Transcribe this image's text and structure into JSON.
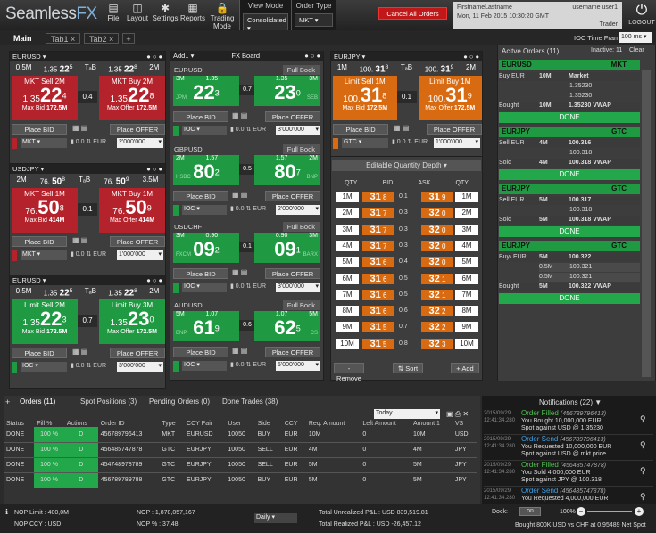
{
  "app": {
    "logo_main": "Seamless",
    "logo_suffix": "FX",
    "cancel_all": "Cancel All Orders",
    "logout": "LOGOUT"
  },
  "toolbar": [
    {
      "label": "File",
      "icon": "file-icon"
    },
    {
      "label": "Layout",
      "icon": "layout-icon"
    },
    {
      "label": "Settings",
      "icon": "gear-icon"
    },
    {
      "label": "Reports",
      "icon": "reports-icon"
    },
    {
      "label": "Trading Mode",
      "icon": "lock-icon"
    }
  ],
  "view_mode": {
    "title": "View Mode",
    "value": "Consolidated"
  },
  "order_type": {
    "title": "Order Type",
    "value": "MKT"
  },
  "user": {
    "name": "FirstnameLastname",
    "username": "username user1",
    "datetime": "Mon, 11 Feb 2015 10:30:20 GMT",
    "role": "Trader"
  },
  "tabs": [
    "Main",
    "Tab1",
    "Tab2"
  ],
  "ioc_time": {
    "label": "IOC Time Frame",
    "value": "100 ms"
  },
  "fx_board": {
    "add": "Add..",
    "title": "FX Board",
    "full_book": "Full Book",
    "tiles": [
      {
        "pair": "EURUSD",
        "left_size": "3M",
        "right_size": "3M",
        "sell_big": "1.35",
        "sell_pips": "22",
        "sell_frac": "3",
        "buy_big": "1.35",
        "buy_pips": "23",
        "buy_frac": "0",
        "spread": "0.7",
        "left_src": "JPM",
        "right_src": "SEB",
        "place_bid": "Place BID",
        "place_offer": "Place OFFER",
        "type": "IOC",
        "qty": "3'000'000",
        "ccy": "EUR"
      },
      {
        "pair": "GBPUSD",
        "left_size": "2M",
        "right_size": "2M",
        "sell_big": "1.57",
        "sell_pips": "80",
        "sell_frac": "2",
        "buy_big": "1.57",
        "buy_pips": "80",
        "buy_frac": "7",
        "spread": "0.5",
        "left_src": "HSBC",
        "right_src": "BNP",
        "place_bid": "Place BID",
        "place_offer": "Place OFFER",
        "type": "IOC",
        "qty": "2'000'000",
        "ccy": "EUR"
      },
      {
        "pair": "USDCHF",
        "left_size": "3M",
        "right_size": "3M",
        "sell_big": "0.90",
        "sell_pips": "09",
        "sell_frac": "2",
        "buy_big": "0.90",
        "buy_pips": "09",
        "buy_frac": "1",
        "spread": "0.1",
        "left_src": "FXCM",
        "right_src": "BARX",
        "place_bid": "Place BID",
        "place_offer": "Place OFFER",
        "type": "IOC",
        "qty": "3'000'000",
        "ccy": "EUR"
      },
      {
        "pair": "AUDUSD",
        "left_size": "5M",
        "right_size": "5M",
        "sell_big": "1.07",
        "sell_pips": "61",
        "sell_frac": "9",
        "buy_big": "1.07",
        "buy_pips": "62",
        "buy_frac": "5",
        "spread": "0.6",
        "left_src": "BNP",
        "right_src": "CS",
        "place_bid": "Place BID",
        "place_offer": "Place OFFER",
        "type": "IOC",
        "qty": "5'000'000",
        "ccy": "EUR"
      }
    ]
  },
  "left_tiles": [
    {
      "pair": "EURUSD",
      "sz_l": "0.5M",
      "big_l": "1.35",
      "mid_l": "22",
      "sm_l": "5",
      "tob": "TₐB",
      "big_r": "1.35",
      "mid_r": "22",
      "sm_r": "8",
      "sz_r": "2M",
      "sell_label": "MKT Sell 2M",
      "buy_label": "MKT Buy 2M",
      "sell_big": "1.35",
      "sell_pips": "22",
      "sell_frac": "4",
      "buy_big": "1.35",
      "buy_pips": "22",
      "buy_frac": "8",
      "spread": "0.4",
      "max_bid": "Max Bid",
      "max_bid_v": "172.5M",
      "max_offer": "Max Offer",
      "max_offer_v": "172.5M",
      "type": "MKT",
      "qty": "2'000'000",
      "color": "red",
      "ccy": "EUR"
    },
    {
      "pair": "USDJPY",
      "sz_l": "2M",
      "big_l": "76.",
      "mid_l": "50",
      "sm_l": "8",
      "tob": "TₐB",
      "big_r": "76.",
      "mid_r": "50",
      "sm_r": "9",
      "sz_r": "3.5M",
      "sell_label": "MKT Sell 1M",
      "buy_label": "MKT Buy 1M",
      "sell_big": "76.",
      "sell_pips": "50",
      "sell_frac": "8",
      "buy_big": "76.",
      "buy_pips": "50",
      "buy_frac": "9",
      "spread": "0.1",
      "max_bid": "Max Bid",
      "max_bid_v": "414M",
      "max_offer": "Max Offer",
      "max_offer_v": "414M",
      "type": "MKT",
      "qty": "1'000'000",
      "color": "red",
      "ccy": "EUR"
    },
    {
      "pair": "EURUSD",
      "sz_l": "0.5M",
      "big_l": "1.35",
      "mid_l": "22",
      "sm_l": "5",
      "tob": "TₐB",
      "big_r": "1.35",
      "mid_r": "22",
      "sm_r": "8",
      "sz_r": "2M",
      "sell_label": "Limit Sell 2M",
      "buy_label": "Limit Buy 3M",
      "sell_big": "1.35",
      "sell_pips": "22",
      "sell_frac": "3",
      "buy_big": "1.35",
      "buy_pips": "23",
      "buy_frac": "0",
      "spread": "0.7",
      "max_bid": "Max Bid",
      "max_bid_v": "172.5M",
      "max_offer": "Max Offer",
      "max_offer_v": "172.5M",
      "type": "IOC",
      "qty": "3'000'000",
      "color": "green",
      "ccy": "EUR"
    }
  ],
  "common": {
    "place_bid": "Place BID",
    "place_offer": "Place OFFER",
    "qty_step": "0.0"
  },
  "eurjpy": {
    "pair": "EURJPY",
    "sz_l": "1M",
    "big_l": "100.",
    "mid_l": "31",
    "sm_l": "8",
    "tob": "TₐB",
    "big_r": "100.",
    "mid_r": "31",
    "sm_r": "9",
    "sz_r": "2M",
    "sell_label": "Limit Sell 1M",
    "buy_label": "Limit Buy 1M",
    "sell_big": "100.",
    "sell_pips": "31",
    "sell_frac": "8",
    "buy_big": "100.",
    "buy_pips": "31",
    "buy_frac": "9",
    "spread": "0.1",
    "max_bid": "Max Bid",
    "max_bid_v": "172.5M",
    "max_offer": "Max Offer",
    "max_offer_v": "172.5M",
    "type": "GTC",
    "qty": "1'000'000",
    "ccy": "EUR",
    "depth_title": "Editable Quantity Depth",
    "depth_hdr": [
      "QTY",
      "BID",
      "ASK",
      "QTY"
    ],
    "depth": [
      {
        "q1": "1M",
        "b": "31",
        "bf": "8",
        "s": "0.1",
        "a": "31",
        "af": "9",
        "q2": "1M"
      },
      {
        "q1": "2M",
        "b": "31",
        "bf": "7",
        "s": "0.3",
        "a": "32",
        "af": "0",
        "q2": "2M"
      },
      {
        "q1": "3M",
        "b": "31",
        "bf": "7",
        "s": "0.3",
        "a": "32",
        "af": "0",
        "q2": "3M"
      },
      {
        "q1": "4M",
        "b": "31",
        "bf": "7",
        "s": "0.3",
        "a": "32",
        "af": "0",
        "q2": "4M"
      },
      {
        "q1": "5M",
        "b": "31",
        "bf": "6",
        "s": "0.4",
        "a": "32",
        "af": "0",
        "q2": "5M"
      },
      {
        "q1": "6M",
        "b": "31",
        "bf": "6",
        "s": "0.5",
        "a": "32",
        "af": "1",
        "q2": "6M"
      },
      {
        "q1": "7M",
        "b": "31",
        "bf": "6",
        "s": "0.5",
        "a": "32",
        "af": "1",
        "q2": "7M"
      },
      {
        "q1": "8M",
        "b": "31",
        "bf": "6",
        "s": "0.6",
        "a": "32",
        "af": "2",
        "q2": "8M"
      },
      {
        "q1": "9M",
        "b": "31",
        "bf": "5",
        "s": "0.7",
        "a": "32",
        "af": "2",
        "q2": "9M"
      },
      {
        "q1": "10M",
        "b": "31",
        "bf": "5",
        "s": "0.8",
        "a": "32",
        "af": "3",
        "q2": "10M"
      }
    ],
    "remove": "- Remove",
    "sort": "Sort",
    "add": "+ Add"
  },
  "active_orders": {
    "title": "Acitve Orders (11)",
    "inactive": "Inactive: 11",
    "clear": "Clear",
    "groups": [
      {
        "pair": "EURUSD",
        "type": "MKT",
        "side": "Buy EUR",
        "qty": "10M",
        "col": "Market",
        "rows": [
          {
            "q": "",
            "p": "1.35230"
          },
          {
            "q": "",
            "p": "1.35230"
          }
        ],
        "fill_label": "Bought",
        "fill_q": "10M",
        "fill_p": "1.35230 VWAP",
        "done": "DONE"
      },
      {
        "pair": "EURJPY",
        "type": "GTC",
        "side": "Sell EUR",
        "qty": "4M",
        "col": "100.316",
        "rows": [
          {
            "q": "",
            "p": "100.318"
          }
        ],
        "fill_label": "Sold",
        "fill_q": "4M",
        "fill_p": "100.318 VWAP",
        "done": "DONE"
      },
      {
        "pair": "EURJPY",
        "type": "GTC",
        "side": "Sell EUR",
        "qty": "5M",
        "col": "100.317",
        "rows": [
          {
            "q": "",
            "p": "100.318"
          }
        ],
        "fill_label": "Sold",
        "fill_q": "5M",
        "fill_p": "100.318 VWAP",
        "done": "DONE"
      },
      {
        "pair": "EURJPY",
        "type": "GTC",
        "side": "Buy/ EUR",
        "qty": "5M",
        "col": "100.322",
        "rows": [
          {
            "q": "0.5M",
            "p": "100.321"
          },
          {
            "q": "0.5M",
            "p": "100.321"
          }
        ],
        "fill_label": "Bought",
        "fill_q": "5M",
        "fill_p": "100.322 VWAP",
        "done": "DONE"
      }
    ]
  },
  "bottom_tabs": [
    "Orders (11)",
    "Spot Positions (3)",
    "Pending Orders (0)",
    "Done Trades (38)"
  ],
  "orders_filter": "Today",
  "orders_cols": [
    "Status",
    "Fill %",
    "Actions",
    "Order ID",
    "Type",
    "CCY Pair",
    "User",
    "Side",
    "CCY",
    "Req. Amount",
    "Left Amount",
    "Amount 1",
    "VS"
  ],
  "orders": [
    [
      "DONE",
      "100 %",
      "D",
      "456789796413",
      "MKT",
      "EURUSD",
      "10050",
      "BUY",
      "EUR",
      "10M",
      "0",
      "10M",
      "USD"
    ],
    [
      "DONE",
      "100 %",
      "D",
      "456485747878",
      "GTC",
      "EURJPY",
      "10050",
      "SELL",
      "EUR",
      "4M",
      "0",
      "4M",
      "JPY"
    ],
    [
      "DONE",
      "100 %",
      "D",
      "454748978789",
      "GTC",
      "EURJPY",
      "10050",
      "SELL",
      "EUR",
      "5M",
      "0",
      "5M",
      "JPY"
    ],
    [
      "DONE",
      "100 %",
      "D",
      "456789789788",
      "GTC",
      "EURJPY",
      "10050",
      "BUY",
      "EUR",
      "5M",
      "0",
      "5M",
      "JPY"
    ]
  ],
  "notifications": {
    "title": "Notifications (22)",
    "items": [
      {
        "date": "2015/09/29",
        "time": "12:41:34.280",
        "title": "Order Filled",
        "id": "(456789796413)",
        "l1": "You Bought 10,000,000 EUR",
        "l2": "Spot against USD @ 1.35230",
        "color": "#4fc34f"
      },
      {
        "date": "2015/09/29",
        "time": "12:41:34.280",
        "title": "Order Send",
        "id": "(456789796413)",
        "l1": "You Requested 10,000,000 EUR",
        "l2": "Spot against USD @ mkt price",
        "color": "#3ea0e8"
      },
      {
        "date": "2015/09/29",
        "time": "12:41:34.280",
        "title": "Order Filled",
        "id": "(456485747878)",
        "l1": "You Sold 4,000,000 EUR",
        "l2": "Spot against JPY @ 100.318",
        "color": "#4fc34f"
      },
      {
        "date": "2015/09/29",
        "time": "12:41:34.280",
        "title": "Order Send",
        "id": "(456485747878)",
        "l1": "You Requested 4,000,000 EUR",
        "l2": "",
        "color": "#3ea0e8"
      }
    ]
  },
  "status": {
    "nop_limit": "NOP Limit : 400,0M",
    "nop_ccy": "NOP CCY : USD",
    "nop": "NOP : 1,878,057,167",
    "nop_pct": "NOP % : 37,48",
    "period": "Daily",
    "unrealized": "Total Unrealized P&L : USD 839,519.81",
    "realized": "Total Realized P&L : USD -26,457.12",
    "dock": "Dock:",
    "dock_val": "on",
    "zoom": "100%",
    "ticker": "Bought 800K USD vs CHF at 0.95489 Net Spot"
  }
}
